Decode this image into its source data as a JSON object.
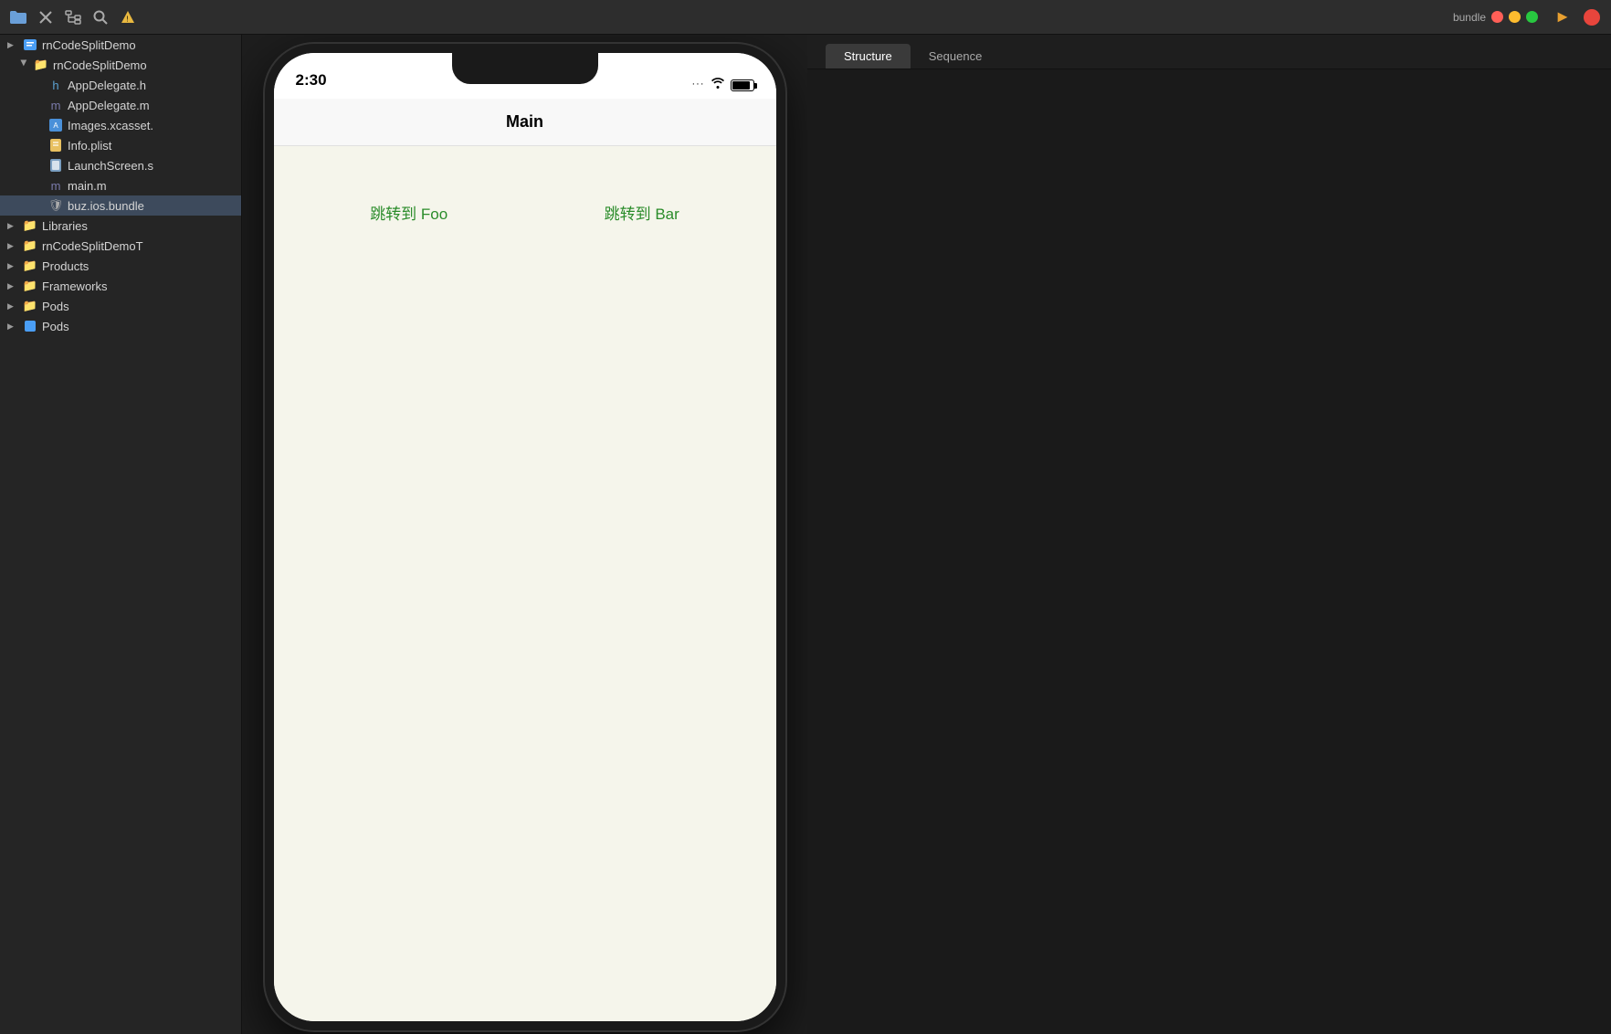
{
  "toolbar": {
    "bundle_label": "bundle",
    "icons": [
      "folder-icon",
      "close-icon",
      "hierarchy-icon",
      "search-icon",
      "warning-icon"
    ]
  },
  "sidebar": {
    "root_item": "rnCodeSplitDemo",
    "items": [
      {
        "id": "root-folder",
        "label": "rnCodeSplitDemo",
        "type": "folder",
        "level": 0,
        "open": true
      },
      {
        "id": "app-delegate-h",
        "label": "AppDelegate.h",
        "type": "file-h",
        "level": 1
      },
      {
        "id": "app-delegate-m",
        "label": "AppDelegate.m",
        "type": "file-m",
        "level": 1
      },
      {
        "id": "images-xcassets",
        "label": "Images.xcasset.",
        "type": "file-xcassets",
        "level": 1
      },
      {
        "id": "info-plist",
        "label": "Info.plist",
        "type": "file-plist",
        "level": 1
      },
      {
        "id": "launch-screen",
        "label": "LaunchScreen.s",
        "type": "file-storyboard",
        "level": 1
      },
      {
        "id": "main-m",
        "label": "main.m",
        "type": "file-m",
        "level": 1
      },
      {
        "id": "buz-bundle",
        "label": "buz.ios.bundle",
        "type": "bundle",
        "level": 1
      },
      {
        "id": "libraries",
        "label": "Libraries",
        "type": "folder",
        "level": 0
      },
      {
        "id": "rncodesplitdemot",
        "label": "rnCodeSplitDemoT",
        "type": "folder",
        "level": 0
      },
      {
        "id": "products",
        "label": "Products",
        "type": "folder",
        "level": 0
      },
      {
        "id": "frameworks",
        "label": "Frameworks",
        "type": "folder",
        "level": 0
      },
      {
        "id": "pods-folder",
        "label": "Pods",
        "type": "folder",
        "level": 0
      },
      {
        "id": "pods-file",
        "label": "Pods",
        "type": "file-pods",
        "level": 0
      }
    ]
  },
  "phone": {
    "time": "2:30",
    "nav_title": "Main",
    "button_foo": "跳转到 Foo",
    "button_bar": "跳转到 Bar",
    "status_signal": "···",
    "status_wifi": "wifi"
  },
  "right_panel": {
    "tabs": [
      {
        "label": "Structure",
        "active": true
      },
      {
        "label": "Sequence",
        "active": false
      }
    ]
  }
}
